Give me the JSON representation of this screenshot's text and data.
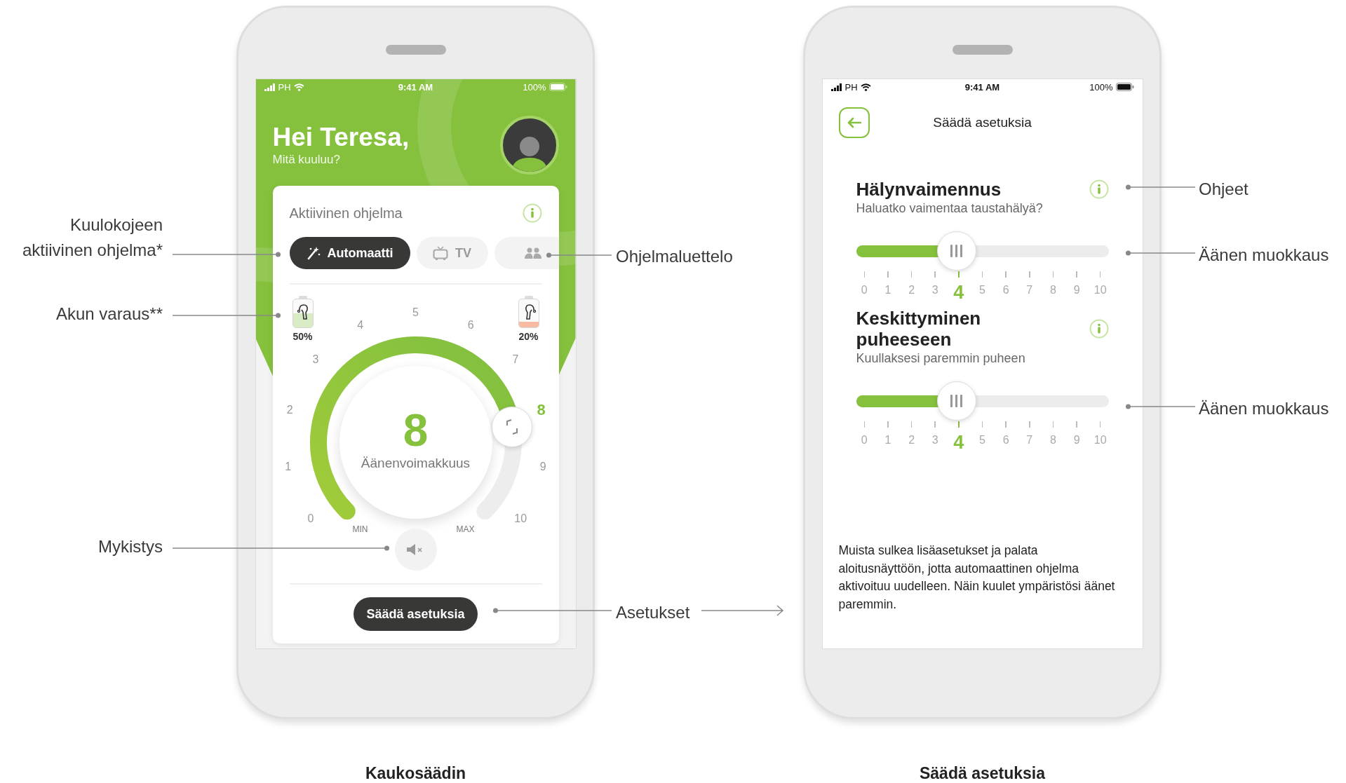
{
  "left_screen": {
    "status_bar": {
      "carrier": "PH",
      "time": "9:41 AM",
      "battery": "100%"
    },
    "greeting": "Hei Teresa,",
    "subtitle": "Mitä kuuluu?",
    "card": {
      "title": "Aktiivinen ohjelma",
      "programs": [
        {
          "kind": "wand",
          "label": "Automaatti",
          "selected": true
        },
        {
          "kind": "tv",
          "label": "TV",
          "selected": false
        },
        {
          "kind": "group",
          "selected": false
        }
      ],
      "batteries": [
        {
          "kind": "left",
          "level": 0.5,
          "color": "#d9ebc4",
          "reading": "50%"
        },
        {
          "kind": "right",
          "level": 0.2,
          "color": "#f7bba3",
          "reading": "20%"
        }
      ],
      "volume": {
        "value": "8",
        "label": "Äänenvoimakkuus",
        "min_label": "MIN",
        "max_label": "MAX",
        "ticks": [
          {
            "label": "0",
            "selected": false
          },
          {
            "label": "1",
            "selected": false
          },
          {
            "label": "2",
            "selected": false
          },
          {
            "label": "3",
            "selected": false
          },
          {
            "label": "4",
            "selected": false
          },
          {
            "label": "5",
            "selected": false
          },
          {
            "label": "6",
            "selected": false
          },
          {
            "label": "7",
            "selected": false
          },
          {
            "label": "8",
            "selected": true
          },
          {
            "label": "9",
            "selected": false
          },
          {
            "label": "10",
            "selected": false
          }
        ]
      },
      "button": "Säädä asetuksia"
    }
  },
  "right_screen": {
    "status_bar": {
      "carrier": "PH",
      "time": "9:41 AM",
      "battery": "100%"
    },
    "title": "Säädä asetuksia",
    "settings": [
      {
        "title": "Hälynvaimennus",
        "description": "Haluatko vaimentaa taustahälyä?",
        "level": 0.4,
        "ticks": [
          {
            "label": "0",
            "selected": false
          },
          {
            "label": "1",
            "selected": false
          },
          {
            "label": "2",
            "selected": false
          },
          {
            "label": "3",
            "selected": false
          },
          {
            "label": "4",
            "selected": true
          },
          {
            "label": "5",
            "selected": false
          },
          {
            "label": "6",
            "selected": false
          },
          {
            "label": "7",
            "selected": false
          },
          {
            "label": "8",
            "selected": false
          },
          {
            "label": "9",
            "selected": false
          },
          {
            "label": "10",
            "selected": false
          }
        ]
      },
      {
        "title": "Keskittyminen puheeseen",
        "description": "Kuullaksesi paremmin puheen",
        "level": 0.4,
        "ticks": [
          {
            "label": "0",
            "selected": false
          },
          {
            "label": "1",
            "selected": false
          },
          {
            "label": "2",
            "selected": false
          },
          {
            "label": "3",
            "selected": false
          },
          {
            "label": "4",
            "selected": true
          },
          {
            "label": "5",
            "selected": false
          },
          {
            "label": "6",
            "selected": false
          },
          {
            "label": "7",
            "selected": false
          },
          {
            "label": "8",
            "selected": false
          },
          {
            "label": "9",
            "selected": false
          },
          {
            "label": "10",
            "selected": false
          }
        ]
      }
    ],
    "note": "Muista sulkea lisäasetukset ja palata aloitusnäyttöön, jotta automaattinen ohjelma aktivoituu uudelleen. Näin kuulet ympäristösi äänet paremmin."
  },
  "callouts": [
    {
      "text": "Kuulokojeen aktiivinen ohjelma*"
    },
    {
      "text": "Akun varaus**"
    },
    {
      "text": "Mykistys"
    },
    {
      "text": "Ohjelmaluettelo"
    },
    {
      "text": "Asetukset"
    },
    {
      "text": "Ohjeet"
    },
    {
      "text": "Äänen muokkaus"
    },
    {
      "text": "Äänen muokkaus"
    }
  ],
  "captions": [
    "Kaukosäädin",
    "Säädä asetuksia"
  ]
}
